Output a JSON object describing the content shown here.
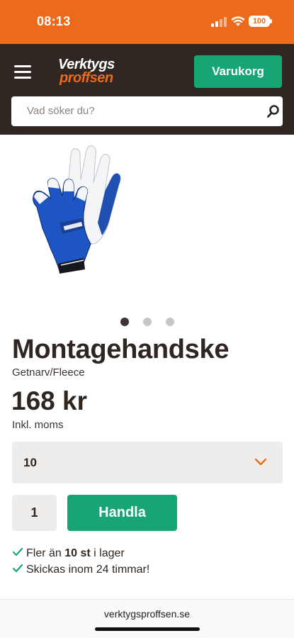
{
  "status_bar": {
    "time": "08:13",
    "battery": "100"
  },
  "header": {
    "logo_line1": "Verktygs",
    "logo_line2": "proffsen",
    "cart_label": "Varukorg",
    "search_placeholder": "Vad söker du?",
    "colors": {
      "brand_orange": "#ec6a1c",
      "dark": "#302723",
      "green": "#17a673"
    }
  },
  "product": {
    "image_icon": "work-glove-image",
    "carousel": {
      "count": 3,
      "active": 0
    },
    "title": "Montagehandske",
    "subtitle": "Getnarv/Fleece",
    "price": "168 kr",
    "vat_note": "Inkl. moms",
    "size_selected": "10",
    "quantity": "1",
    "buy_label": "Handla",
    "stock_prefix": "Fler än",
    "stock_count": "10 st",
    "stock_suffix": "i lager",
    "shipping": "Skickas inom 24 timmar!"
  },
  "browser": {
    "url": "verktygsproffsen.se"
  }
}
